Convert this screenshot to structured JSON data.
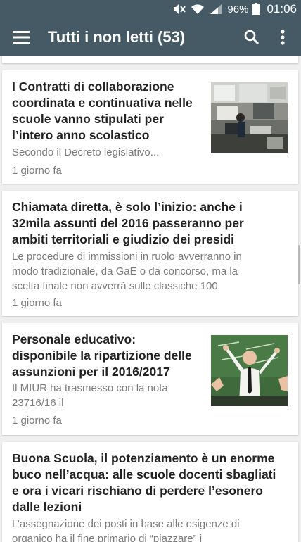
{
  "status_bar": {
    "battery": "96%",
    "time": "01:06",
    "icons": [
      "mute-icon",
      "wifi-icon",
      "signal-icon",
      "battery-icon"
    ]
  },
  "app_bar": {
    "title": "Tutti i non letti (53)",
    "menu_icon": "menu-icon",
    "search_icon": "search-icon",
    "overflow_icon": "more-vert-icon",
    "color": "#455a64"
  },
  "articles": [
    {
      "headline": [
        "I Contratti di collaborazione",
        "coordinata e continuativa nelle",
        "scuole vanno stipulati per",
        "l’intero anno scolastico"
      ],
      "summary": [
        "Secondo il Decreto legislativo..."
      ],
      "age": "1 giorno fa",
      "has_thumbnail": true
    },
    {
      "headline": [
        "Chiamata diretta, è solo l’inizio: anche i",
        "32mila assunti del 2016 passeranno per",
        "ambiti territoriali e giudizio dei presidi"
      ],
      "summary": [
        "Le procedure di immissioni in ruolo avverranno in",
        "modo tradizionale, da GaE o da concorso, ma la",
        "scelta finale non avverrà sulle classiche 100"
      ],
      "age": "1 giorno fa",
      "has_thumbnail": false
    },
    {
      "headline": [
        "Personale educativo:",
        "disponibile la ripartizione delle",
        "assunzioni per il 2016/2017"
      ],
      "summary": [
        "Il MIUR ha trasmesso con la nota",
        "23716/16 il"
      ],
      "age": "1 giorno fa",
      "has_thumbnail": true
    },
    {
      "headline": [
        "Buona Scuola, il potenziamento è un enorme",
        "buco nell’acqua: alle scuole docenti sbagliati",
        "e ora i vicari rischiano di perdere l’esonero",
        "dalle lezioni"
      ],
      "summary": [
        "L’assegnazione dei posti in base alle esigenze di",
        "organico ha il fine primario di “piazzare” i"
      ],
      "age": "",
      "has_thumbnail": false
    }
  ]
}
